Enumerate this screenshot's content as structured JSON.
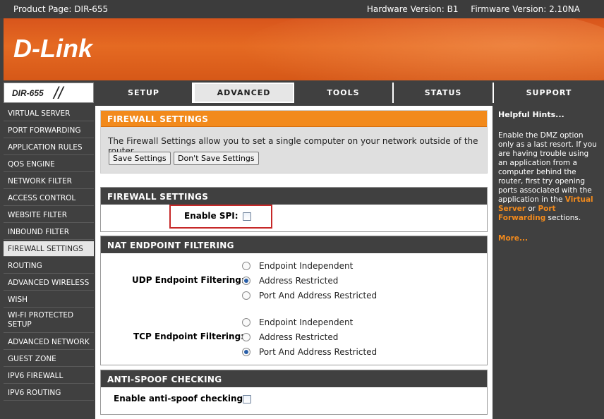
{
  "topbar": {
    "product": "Product Page: DIR-655",
    "hardware": "Hardware Version: B1",
    "firmware": "Firmware Version: 2.10NA"
  },
  "banner": {
    "logo": "D-Link"
  },
  "model": {
    "name": "DIR-655",
    "slashes": "//"
  },
  "nav": {
    "setup": "SETUP",
    "advanced": "ADVANCED",
    "tools": "TOOLS",
    "status": "STATUS",
    "support": "SUPPORT"
  },
  "menu": {
    "items": [
      "VIRTUAL SERVER",
      "PORT FORWARDING",
      "APPLICATION RULES",
      "QOS ENGINE",
      "NETWORK FILTER",
      "ACCESS CONTROL",
      "WEBSITE FILTER",
      "INBOUND FILTER",
      "FIREWALL SETTINGS",
      "ROUTING",
      "ADVANCED WIRELESS",
      "WISH",
      "WI-FI PROTECTED SETUP",
      "ADVANCED NETWORK",
      "GUEST ZONE",
      "IPV6 FIREWALL",
      "IPV6 ROUTING"
    ]
  },
  "info": {
    "title": "FIREWALL SETTINGS",
    "description": "The Firewall Settings allow you to set a single computer on your network outside of the router.",
    "save": "Save Settings",
    "dont_save": "Don't Save Settings"
  },
  "firewall": {
    "title": "FIREWALL SETTINGS",
    "spi_label": "Enable SPI:",
    "spi_checked": false
  },
  "nat": {
    "title": "NAT ENDPOINT FILTERING",
    "udp_label": "UDP Endpoint Filtering:",
    "tcp_label": "TCP Endpoint Filtering:",
    "options": [
      "Endpoint Independent",
      "Address Restricted",
      "Port And Address Restricted"
    ],
    "udp_selected": "Address Restricted",
    "tcp_selected": "Port And Address Restricted"
  },
  "antispoof": {
    "title": "ANTI-SPOOF CHECKING",
    "label": "Enable anti-spoof checking:",
    "checked": false
  },
  "hints": {
    "title": "Helpful Hints...",
    "text1": "Enable the DMZ option only as a last resort. If you are having trouble using an application from a computer behind the router, first try opening ports associated with the application in the ",
    "link1": "Virtual Server",
    "or": " or ",
    "link2": "Port Forwarding",
    "text2": " sections.",
    "more": "More..."
  },
  "colors": {
    "accent_orange": "#f28a1c",
    "dark_bar": "#404040",
    "highlight_red": "#c62828"
  }
}
